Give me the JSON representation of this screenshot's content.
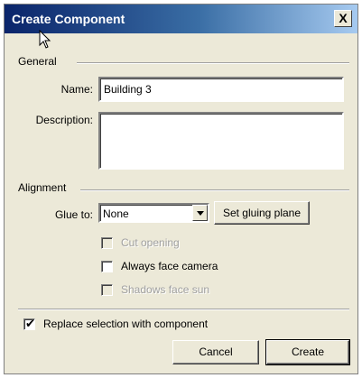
{
  "window": {
    "title": "Create Component",
    "close_label": "X"
  },
  "general": {
    "label": "General",
    "name_label": "Name:",
    "name_value": "Building 3",
    "description_label": "Description:",
    "description_value": ""
  },
  "alignment": {
    "label": "Alignment",
    "glue_label": "Glue to:",
    "glue_value": "None",
    "set_gluing_plane": "Set gluing plane",
    "cut_opening": {
      "label": "Cut opening",
      "checked": false,
      "enabled": false
    },
    "always_face_camera": {
      "label": "Always face camera",
      "checked": false,
      "enabled": true
    },
    "shadows_face_sun": {
      "label": "Shadows face sun",
      "checked": false,
      "enabled": false
    }
  },
  "replace_selection": {
    "label": "Replace selection with component",
    "checked": true,
    "mark": "✔"
  },
  "footer": {
    "cancel": "Cancel",
    "create": "Create"
  }
}
